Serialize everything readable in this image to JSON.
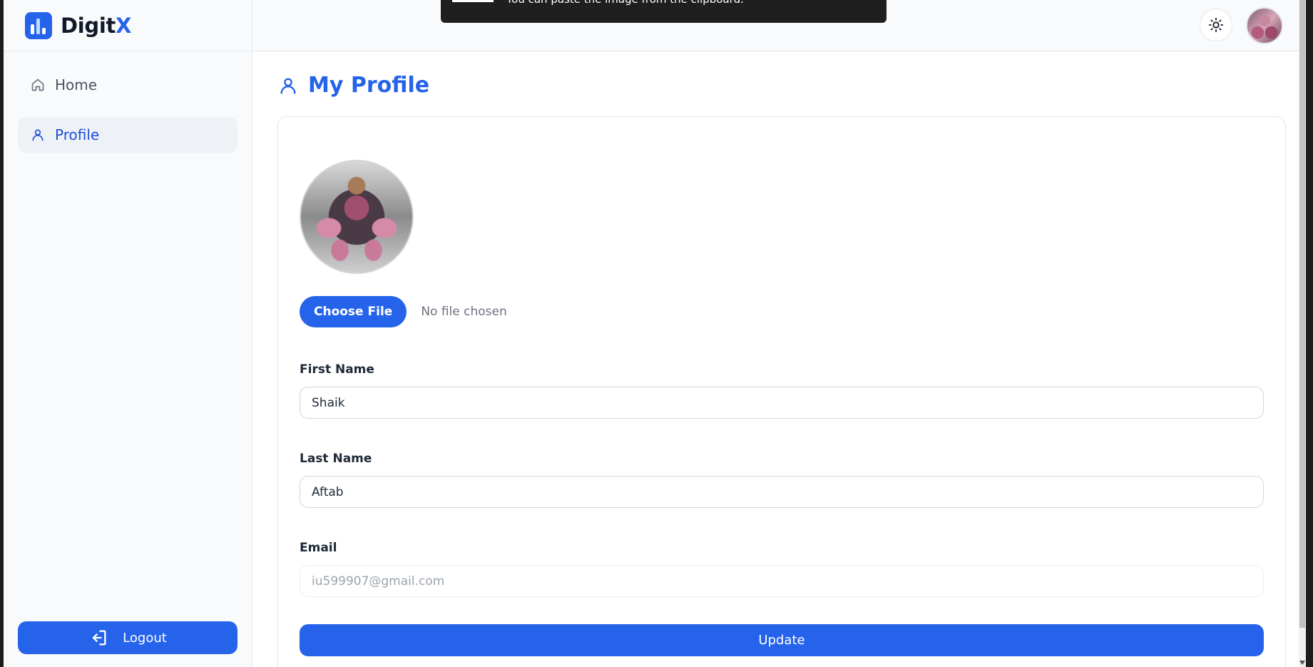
{
  "brand": {
    "name_main": "Digit",
    "name_accent": "X"
  },
  "sidebar": {
    "items": [
      {
        "label": "Home",
        "icon": "home-icon",
        "active": false
      },
      {
        "label": "Profile",
        "icon": "user-icon",
        "active": true
      }
    ],
    "logout_label": "Logout"
  },
  "toast": {
    "message": "You can paste the image from the clipboard."
  },
  "header": {
    "theme_icon": "sun-icon",
    "avatar": "user-avatar"
  },
  "page": {
    "title": "My Profile"
  },
  "form": {
    "choose_file_label": "Choose File",
    "file_status": "No file chosen",
    "first_name_label": "First Name",
    "first_name_value": "Shaik",
    "last_name_label": "Last Name",
    "last_name_value": "Aftab",
    "email_label": "Email",
    "email_placeholder": "iu599907@gmail.com",
    "update_label": "Update"
  },
  "colors": {
    "accent": "#2563eb",
    "sidebar_active_bg": "#eef2f7"
  }
}
